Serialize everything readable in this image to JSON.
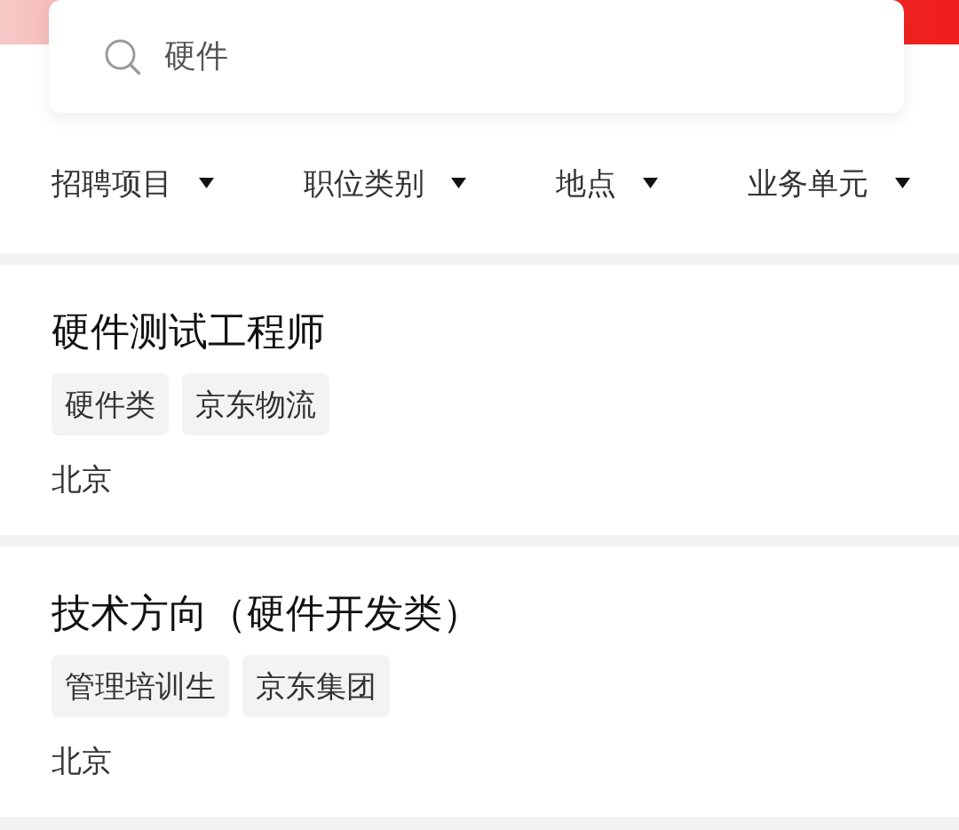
{
  "search": {
    "value": "硬件"
  },
  "filters": [
    {
      "label": "招聘项目"
    },
    {
      "label": "职位类别"
    },
    {
      "label": "地点"
    },
    {
      "label": "业务单元"
    }
  ],
  "jobs": [
    {
      "title": "硬件测试工程师",
      "tags": [
        "硬件类",
        "京东物流"
      ],
      "location": "北京"
    },
    {
      "title": "技术方向（硬件开发类）",
      "tags": [
        "管理培训生",
        "京东集团"
      ],
      "location": "北京"
    }
  ]
}
